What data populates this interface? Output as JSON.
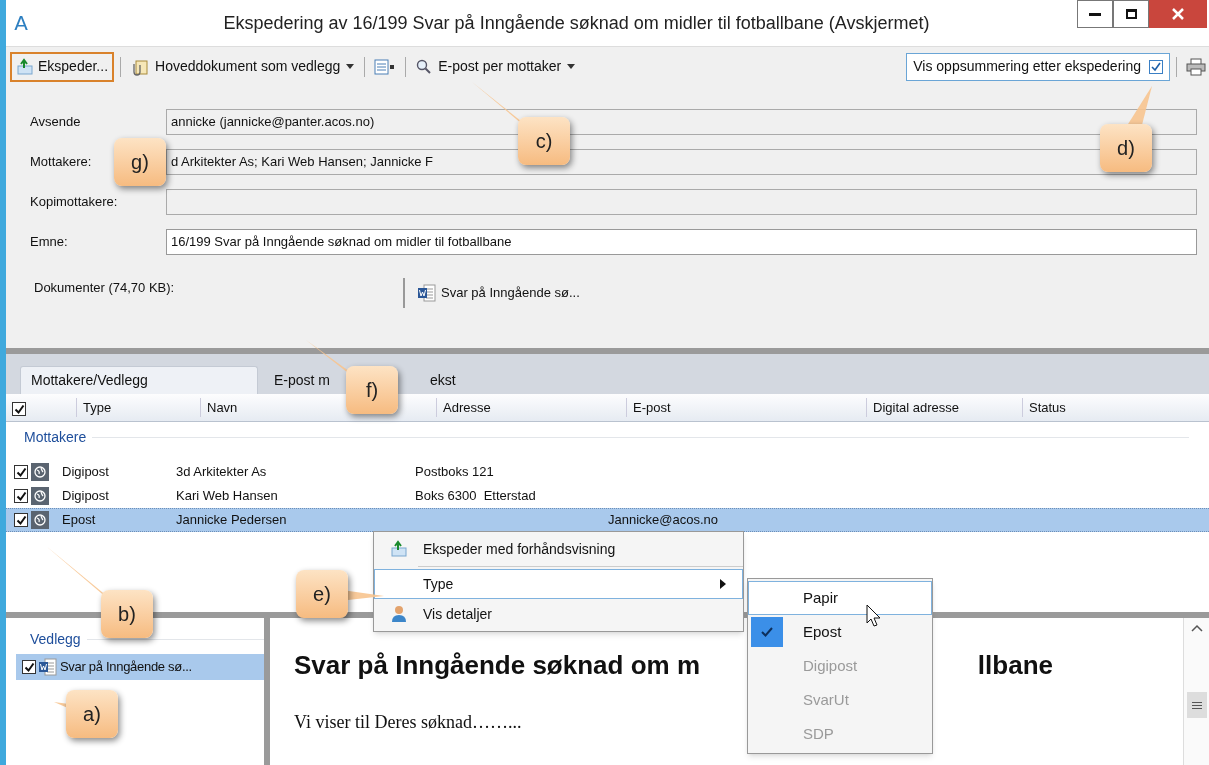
{
  "window": {
    "title": "Ekspedering av 16/199 Svar på Inngående søknad om midler til fotballbane (Avskjermet)",
    "app_icon": "A"
  },
  "toolbar": {
    "items": [
      {
        "kind": "button",
        "label": "Ekspeder...",
        "highlighted": true
      },
      {
        "kind": "dropdown",
        "label": "Hoveddokument som vedlegg",
        "highlighted": false
      },
      {
        "kind": "icon",
        "highlighted": false
      },
      {
        "kind": "dropdown",
        "label": "E-post per mottaker",
        "highlighted": false
      }
    ],
    "summary_option": {
      "label": "Vis oppsummering etter ekspedering",
      "checked": true
    }
  },
  "fields": [
    {
      "label": "Avsende",
      "value": "annicke (jannicke@panter.acos.no)",
      "editable": false
    },
    {
      "label": "Mottakere:",
      "value": "d Arkitekter As; Kari Web Hansen; Jannicke F",
      "editable": false
    },
    {
      "label": "Kopimottakere:",
      "editable": false
    },
    {
      "label": "Emne:",
      "value": "16/199 Svar på Inngående søknad om midler til fotballbane",
      "editable": true
    }
  ],
  "documents": {
    "label": "Dokumenter (74,70 KB):",
    "files": [
      "Svar på Inngående sø..."
    ]
  },
  "tabs": [
    {
      "label": "Mottakere/Vedlegg",
      "selected": true
    },
    {
      "label": "E-post m",
      "label_end": "ekst",
      "selected": false
    }
  ],
  "grid": {
    "all_checked": true,
    "columns": [
      "Type",
      "Navn",
      "Adresse",
      "E-post",
      "Digital adresse",
      "Status"
    ],
    "group": "Mottakere",
    "rows": [
      {
        "checked": true,
        "type": "Digipost",
        "name": "3d Arkitekter As",
        "address": "Postboks 121",
        "selected": false
      },
      {
        "checked": true,
        "type": "Digipost",
        "name": "Kari Web Hansen",
        "address": "Boks 6300  Etterstad",
        "selected": false
      },
      {
        "checked": true,
        "type": "Epost",
        "name": "Jannicke Pedersen",
        "email": "Jannicke@acos.no",
        "selected": true
      }
    ]
  },
  "attachments": {
    "title": "Vedlegg",
    "items": [
      {
        "checked": true,
        "name": "Svar på Inngående sø...",
        "selected": true
      }
    ]
  },
  "preview": {
    "heading_start": "Svar på Inngående søknad om m",
    "heading_end": "llbane",
    "body": "Vi viser til Deres søknad……..."
  },
  "context_menu": {
    "items": [
      {
        "label": "Ekspeder med forhåndsvisning",
        "highlighted": false,
        "submenu": false
      },
      {
        "label": "Type",
        "highlighted": true,
        "submenu": true
      },
      {
        "label": "Vis detaljer",
        "highlighted": false,
        "submenu": false
      }
    ]
  },
  "submenu": {
    "items": [
      {
        "label": "Papir",
        "highlighted": true,
        "checked": false,
        "disabled": false
      },
      {
        "label": "Epost",
        "highlighted": false,
        "checked": true,
        "disabled": false
      },
      {
        "label": "Digipost",
        "highlighted": false,
        "checked": false,
        "disabled": true
      },
      {
        "label": "SvarUt",
        "highlighted": false,
        "checked": false,
        "disabled": true
      },
      {
        "label": "SDP",
        "highlighted": false,
        "checked": false,
        "disabled": true
      }
    ]
  },
  "callouts": [
    {
      "label": "g)"
    },
    {
      "label": "c)"
    },
    {
      "label": "d)"
    },
    {
      "label": "f)"
    },
    {
      "label": "b)"
    },
    {
      "label": "e)"
    },
    {
      "label": "a)"
    }
  ]
}
